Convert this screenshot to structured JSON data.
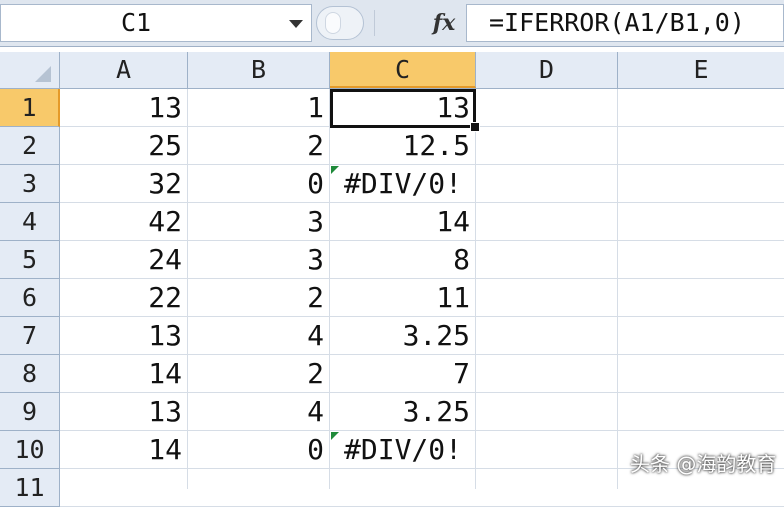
{
  "name_box": {
    "value": "C1"
  },
  "formula_bar": {
    "fx_label": "fx",
    "formula": "=IFERROR(A1/B1,0)"
  },
  "columns": [
    "A",
    "B",
    "C",
    "D",
    "E"
  ],
  "selected_column": "C",
  "selected_row": "1",
  "rows": [
    {
      "row": "1",
      "A": "13",
      "B": "1",
      "C": "13"
    },
    {
      "row": "2",
      "A": "25",
      "B": "2",
      "C": "12.5"
    },
    {
      "row": "3",
      "A": "32",
      "B": "0",
      "C": "#DIV/0!"
    },
    {
      "row": "4",
      "A": "42",
      "B": "3",
      "C": "14"
    },
    {
      "row": "5",
      "A": "24",
      "B": "3",
      "C": "8"
    },
    {
      "row": "6",
      "A": "22",
      "B": "2",
      "C": "11"
    },
    {
      "row": "7",
      "A": "13",
      "B": "4",
      "C": "3.25"
    },
    {
      "row": "8",
      "A": "14",
      "B": "2",
      "C": "7"
    },
    {
      "row": "9",
      "A": "13",
      "B": "4",
      "C": "3.25"
    },
    {
      "row": "10",
      "A": "14",
      "B": "0",
      "C": "#DIV/0!"
    },
    {
      "row": "11",
      "A": "",
      "B": "",
      "C": ""
    }
  ],
  "error_indicator_color": "#1f8a3a",
  "selection_color": "#f8c96a",
  "watermark": "头条 @海韵教育"
}
